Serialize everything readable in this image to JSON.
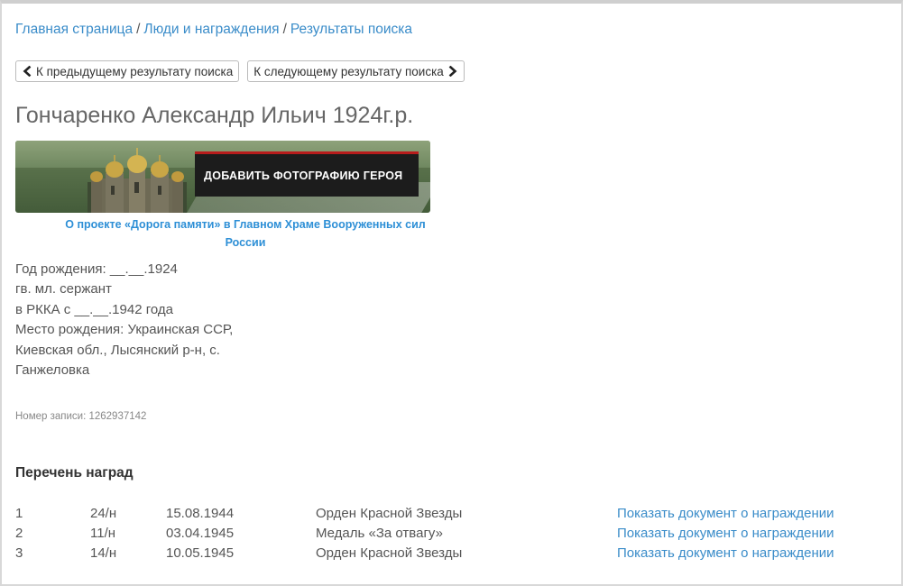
{
  "breadcrumb": {
    "home": "Главная страница",
    "people": "Люди и награждения",
    "results": "Результаты поиска",
    "separator": "/"
  },
  "nav": {
    "prev_label": "К предыдущему результату поиска",
    "next_label": "К следующему результату поиска"
  },
  "person": {
    "title": "Гончаренко Александр Ильич 1924г.р.",
    "birth_year": "Год рождения: __.__.1924",
    "rank": "гв. мл. сержант",
    "service": "в РККА с __.__.1942 года",
    "birthplace_line1": "Место рождения: Украинская ССР,",
    "birthplace_line2": "Киевская обл., Лысянский р-н, с.",
    "birthplace_line3": "Ганжеловка",
    "record": "Номер записи: 1262937142"
  },
  "banner": {
    "add_photo_label": "ДОБАВИТЬ ФОТОГРАФИЮ ГЕРОЯ",
    "about_line1": "О проекте «Дорога памяти» в Главном Храме Вооруженных сил",
    "about_line2": "России"
  },
  "awards": {
    "title": "Перечень наград",
    "rows": [
      {
        "num": "1",
        "doc": "24/н",
        "date": "15.08.1944",
        "name": "Орден Красной Звезды",
        "link": "Показать документ о награждении"
      },
      {
        "num": "2",
        "doc": "11/н",
        "date": "03.04.1945",
        "name": "Медаль «За отвагу»",
        "link": "Показать документ о награждении"
      },
      {
        "num": "3",
        "doc": "14/н",
        "date": "10.05.1945",
        "name": "Орден Красной Звезды",
        "link": "Показать документ о награждении"
      }
    ]
  },
  "colors": {
    "link": "#3a8cc9",
    "accent_red": "#b71c1c",
    "text": "#555555"
  },
  "icons": {
    "prev": "chevron-left-icon",
    "next": "chevron-right-icon"
  }
}
